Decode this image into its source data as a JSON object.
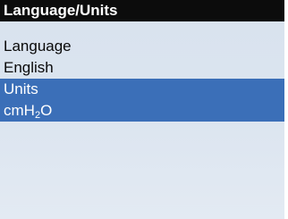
{
  "screen": {
    "title": "Language/Units"
  },
  "settings": [
    {
      "label": "Language",
      "value": "English",
      "selected": false
    },
    {
      "label": "Units",
      "value": "cmH2O",
      "value_main": "cmH",
      "value_sub": "2",
      "value_tail": "O",
      "selected": true
    }
  ],
  "colors": {
    "titlebar_bg": "#0c0c0c",
    "selected_bg": "#3b6fb8",
    "screen_bg": "#dce5f0"
  }
}
